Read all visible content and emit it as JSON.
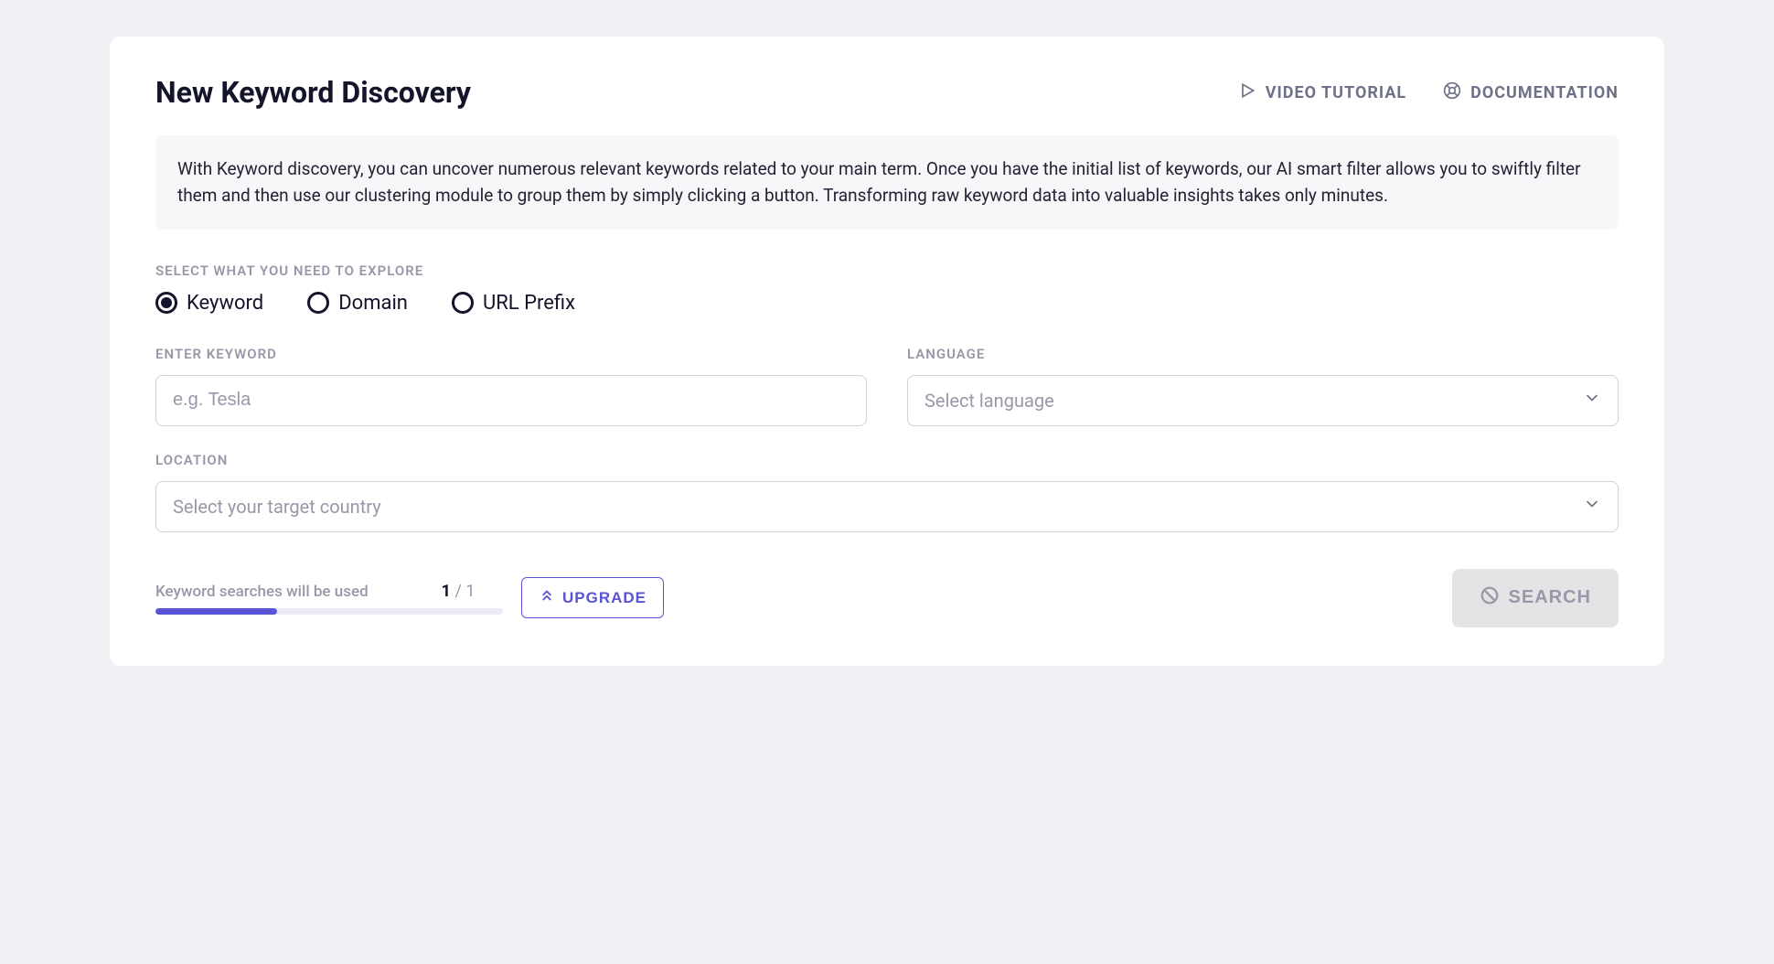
{
  "header": {
    "title": "New Keyword Discovery",
    "links": {
      "video_tutorial": "VIDEO TUTORIAL",
      "documentation": "DOCUMENTATION"
    }
  },
  "info_text": "With Keyword discovery, you can uncover numerous relevant keywords related to your main term. Once you have the initial list of keywords, our AI smart filter allows you to swiftly filter them and then use our clustering module to group them by simply clicking a button. Transforming raw keyword data into valuable insights takes only minutes.",
  "explore": {
    "section_label": "SELECT WHAT YOU NEED TO EXPLORE",
    "options": {
      "keyword": "Keyword",
      "domain": "Domain",
      "url_prefix": "URL Prefix"
    },
    "selected": "keyword"
  },
  "form": {
    "keyword": {
      "label": "ENTER KEYWORD",
      "placeholder": "e.g. Tesla",
      "value": ""
    },
    "language": {
      "label": "LANGUAGE",
      "placeholder": "Select language",
      "value": ""
    },
    "location": {
      "label": "LOCATION",
      "placeholder": "Select your target country",
      "value": ""
    }
  },
  "usage": {
    "label": "Keyword searches will be used",
    "used": "1",
    "separator": " / ",
    "total": "1",
    "upgrade_label": "UPGRADE"
  },
  "search_button": "SEARCH"
}
